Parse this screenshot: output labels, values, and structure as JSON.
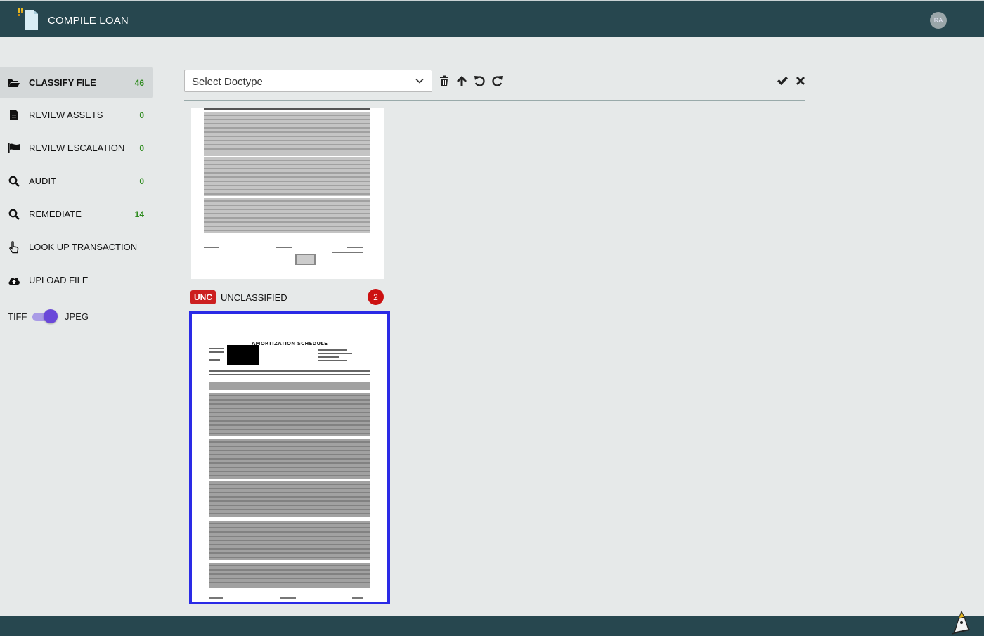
{
  "header": {
    "app_title": "COMPILE LOAN",
    "avatar_initials": "RA"
  },
  "sidebar": {
    "items": [
      {
        "label": "CLASSIFY FILE",
        "count": "46",
        "icon": "folder-open-icon",
        "active": true
      },
      {
        "label": "REVIEW ASSETS",
        "count": "0",
        "icon": "document-icon"
      },
      {
        "label": "REVIEW ESCALATION",
        "count": "0",
        "icon": "flag-icon"
      },
      {
        "label": "AUDIT",
        "count": "0",
        "icon": "search-icon"
      },
      {
        "label": "REMEDIATE",
        "count": "14",
        "icon": "search-icon"
      },
      {
        "label": "LOOK UP TRANSACTION",
        "count": "",
        "icon": "hand-pointer-icon"
      },
      {
        "label": "UPLOAD FILE",
        "count": "",
        "icon": "cloud-upload-icon"
      }
    ],
    "toggle": {
      "left_label": "TIFF",
      "right_label": "JPEG",
      "state": "JPEG"
    }
  },
  "toolbar": {
    "doctype_placeholder": "Select Doctype"
  },
  "documents": {
    "group_badge": "UNC",
    "group_label": "UNCLASSIFIED",
    "group_count": "2",
    "page2_title": "AMORTIZATION SCHEDULE"
  },
  "colors": {
    "header_bg": "#27474f",
    "count_green": "#2e8b1e",
    "badge_red": "#cc1f1f",
    "selection_blue": "#2a2ae6",
    "toggle_purple": "#6a48d9"
  }
}
